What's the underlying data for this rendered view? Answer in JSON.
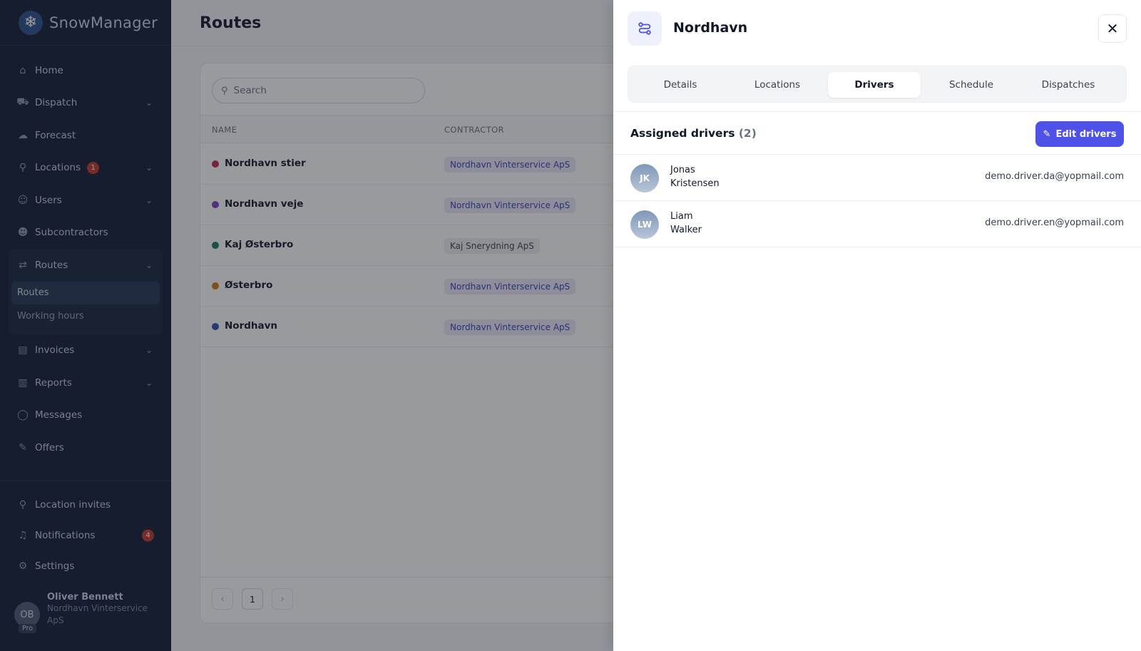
{
  "brand": {
    "name": "SnowManager",
    "logo_icon": "❄"
  },
  "sidebar": {
    "items": [
      {
        "name": "home",
        "label": "Home",
        "icon": "⌂",
        "chevron": false
      },
      {
        "name": "dispatch",
        "label": "Dispatch",
        "icon": "⛟",
        "chevron": true
      },
      {
        "name": "forecast",
        "label": "Forecast",
        "icon": "☁",
        "chevron": false
      },
      {
        "name": "locations",
        "label": "Locations",
        "icon": "⚲",
        "chevron": true,
        "badge": "1"
      },
      {
        "name": "users",
        "label": "Users",
        "icon": "☺",
        "chevron": true
      },
      {
        "name": "subcontractors",
        "label": "Subcontractors",
        "icon": "☻",
        "chevron": false
      },
      {
        "name": "routes",
        "label": "Routes",
        "icon": "⇄",
        "chevron": true
      },
      {
        "name": "invoices",
        "label": "Invoices",
        "icon": "▤",
        "chevron": true
      },
      {
        "name": "reports",
        "label": "Reports",
        "icon": "▥",
        "chevron": true
      },
      {
        "name": "messages",
        "label": "Messages",
        "icon": "◯",
        "chevron": false
      },
      {
        "name": "offers",
        "label": "Offers",
        "icon": "✎",
        "chevron": false
      }
    ],
    "routes_sub": [
      {
        "label": "Routes",
        "active": true
      },
      {
        "label": "Working hours",
        "active": false
      }
    ],
    "bottom": [
      {
        "name": "location-invites",
        "label": "Location invites",
        "icon": "⚲"
      },
      {
        "name": "notifications",
        "label": "Notifications",
        "icon": "♫",
        "badge": "4"
      },
      {
        "name": "settings",
        "label": "Settings",
        "icon": "⚙"
      }
    ],
    "chevron_icon": "⌄"
  },
  "user": {
    "initials": "OB",
    "tag": "Pro",
    "name": "Oliver Bennett",
    "org": "Nordhavn Vinterservice ApS"
  },
  "main": {
    "title": "Routes",
    "search_placeholder": "Search",
    "columns": {
      "name": "Name",
      "contractor": "Contractor"
    },
    "rows": [
      {
        "name": "Nordhavn stier",
        "color": "#c0284f",
        "contractor": "Nordhavn Vinterservice ApS",
        "chip": "blue"
      },
      {
        "name": "Nordhavn veje",
        "color": "#7b3fc0",
        "contractor": "Nordhavn Vinterservice ApS",
        "chip": "blue"
      },
      {
        "name": "Kaj Østerbro",
        "color": "#1a7a5e",
        "contractor": "Kaj Snerydning ApS",
        "chip": "grey"
      },
      {
        "name": "Østerbro",
        "color": "#c77a1a",
        "contractor": "Nordhavn Vinterservice ApS",
        "chip": "blue"
      },
      {
        "name": "Nordhavn",
        "color": "#2f4fb3",
        "contractor": "Nordhavn Vinterservice ApS",
        "chip": "blue"
      }
    ],
    "pagination": {
      "prev": "‹",
      "page": "1",
      "next": "›"
    }
  },
  "panel": {
    "title": "Nordhavn",
    "close": "✕",
    "tabs": [
      {
        "label": "Details",
        "active": false
      },
      {
        "label": "Locations",
        "active": false
      },
      {
        "label": "Drivers",
        "active": true
      },
      {
        "label": "Schedule",
        "active": false
      },
      {
        "label": "Dispatches",
        "active": false
      }
    ],
    "assigned_label": "Assigned drivers",
    "assigned_count": "(2)",
    "edit_label": "Edit drivers",
    "edit_icon": "✎",
    "drivers": [
      {
        "initials": "JK",
        "first": "Jonas",
        "last": "Kristensen",
        "email": "demo.driver.da@yopmail.com"
      },
      {
        "initials": "LW",
        "first": "Liam",
        "last": "Walker",
        "email": "demo.driver.en@yopmail.com"
      }
    ]
  }
}
